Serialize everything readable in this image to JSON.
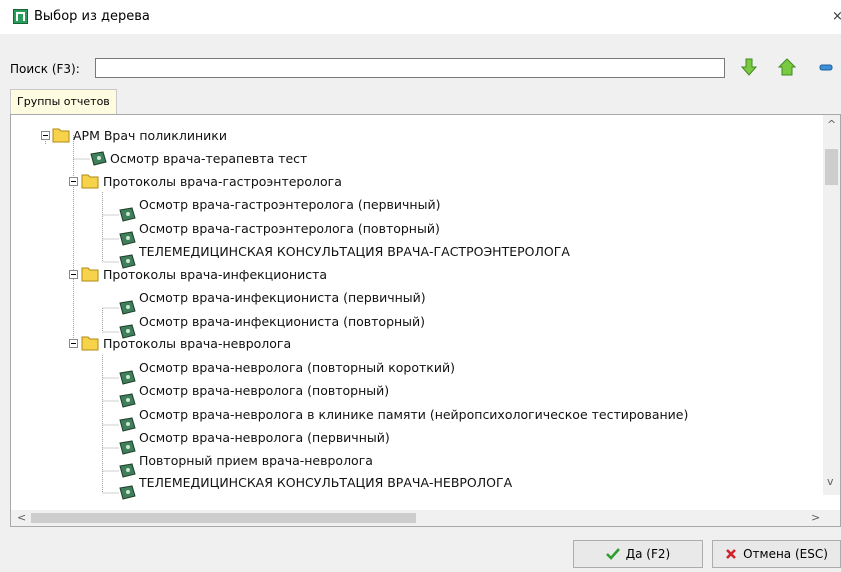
{
  "window": {
    "title": "Выбор из дерева",
    "close": "×"
  },
  "search": {
    "label": "Поиск (F3):",
    "value": ""
  },
  "toolbar": {
    "down_icon": "arrow-down-green",
    "home_icon": "home-green",
    "collapse_icon": "minus-blue"
  },
  "tab": {
    "label": "Группы отчетов"
  },
  "tree": {
    "root": "АРМ  Врач поликлиники",
    "rows": [
      {
        "type": "leaf",
        "label": "Осмотр врача-терапевта тест"
      },
      {
        "type": "folder",
        "label": "Протоколы врача-гастроэнтеролога"
      },
      {
        "type": "leaf",
        "label": "Осмотр врача-гастроэнтеролога (первичный)"
      },
      {
        "type": "leaf",
        "label": "Осмотр врача-гастроэнтеролога (повторный)"
      },
      {
        "type": "leaf",
        "label": "ТЕЛЕМЕДИЦИНСКАЯ КОНСУЛЬТАЦИЯ ВРАЧА-ГАСТРОЭНТЕРОЛОГА"
      },
      {
        "type": "folder",
        "label": "Протоколы врача-инфекциониста"
      },
      {
        "type": "leaf",
        "label": "Осмотр врача-инфекциониста (первичный)"
      },
      {
        "type": "leaf",
        "label": "Осмотр врача-инфекциониста (повторный)"
      },
      {
        "type": "folder",
        "label": "Протоколы врача-невролога"
      },
      {
        "type": "leaf",
        "label": "Осмотр врача-невролога (повторный короткий)"
      },
      {
        "type": "leaf",
        "label": "Осмотр врача-невролога (повторный)"
      },
      {
        "type": "leaf",
        "label": "Осмотр врача-невролога в клинике памяти (нейропсихологическое тестирование)"
      },
      {
        "type": "leaf",
        "label": "Осмотр врача-невролога (первичный)"
      },
      {
        "type": "leaf",
        "label": "Повторный прием врача-невролога"
      },
      {
        "type": "leaf",
        "label": "ТЕЛЕМЕДИЦИНСКАЯ КОНСУЛЬТАЦИЯ ВРАЧА-НЕВРОЛОГА"
      }
    ]
  },
  "scroll": {
    "up": "^",
    "down": "v",
    "left": "<",
    "right": ">"
  },
  "buttons": {
    "ok": "Да (F2)",
    "cancel": "Отмена (ESC)"
  },
  "colors": {
    "folder": "#f6d34a",
    "report": "#3f7f5a",
    "ok_check": "#2f9e2f",
    "cancel_x": "#d2232a",
    "tab_bg": "#fefce0"
  }
}
